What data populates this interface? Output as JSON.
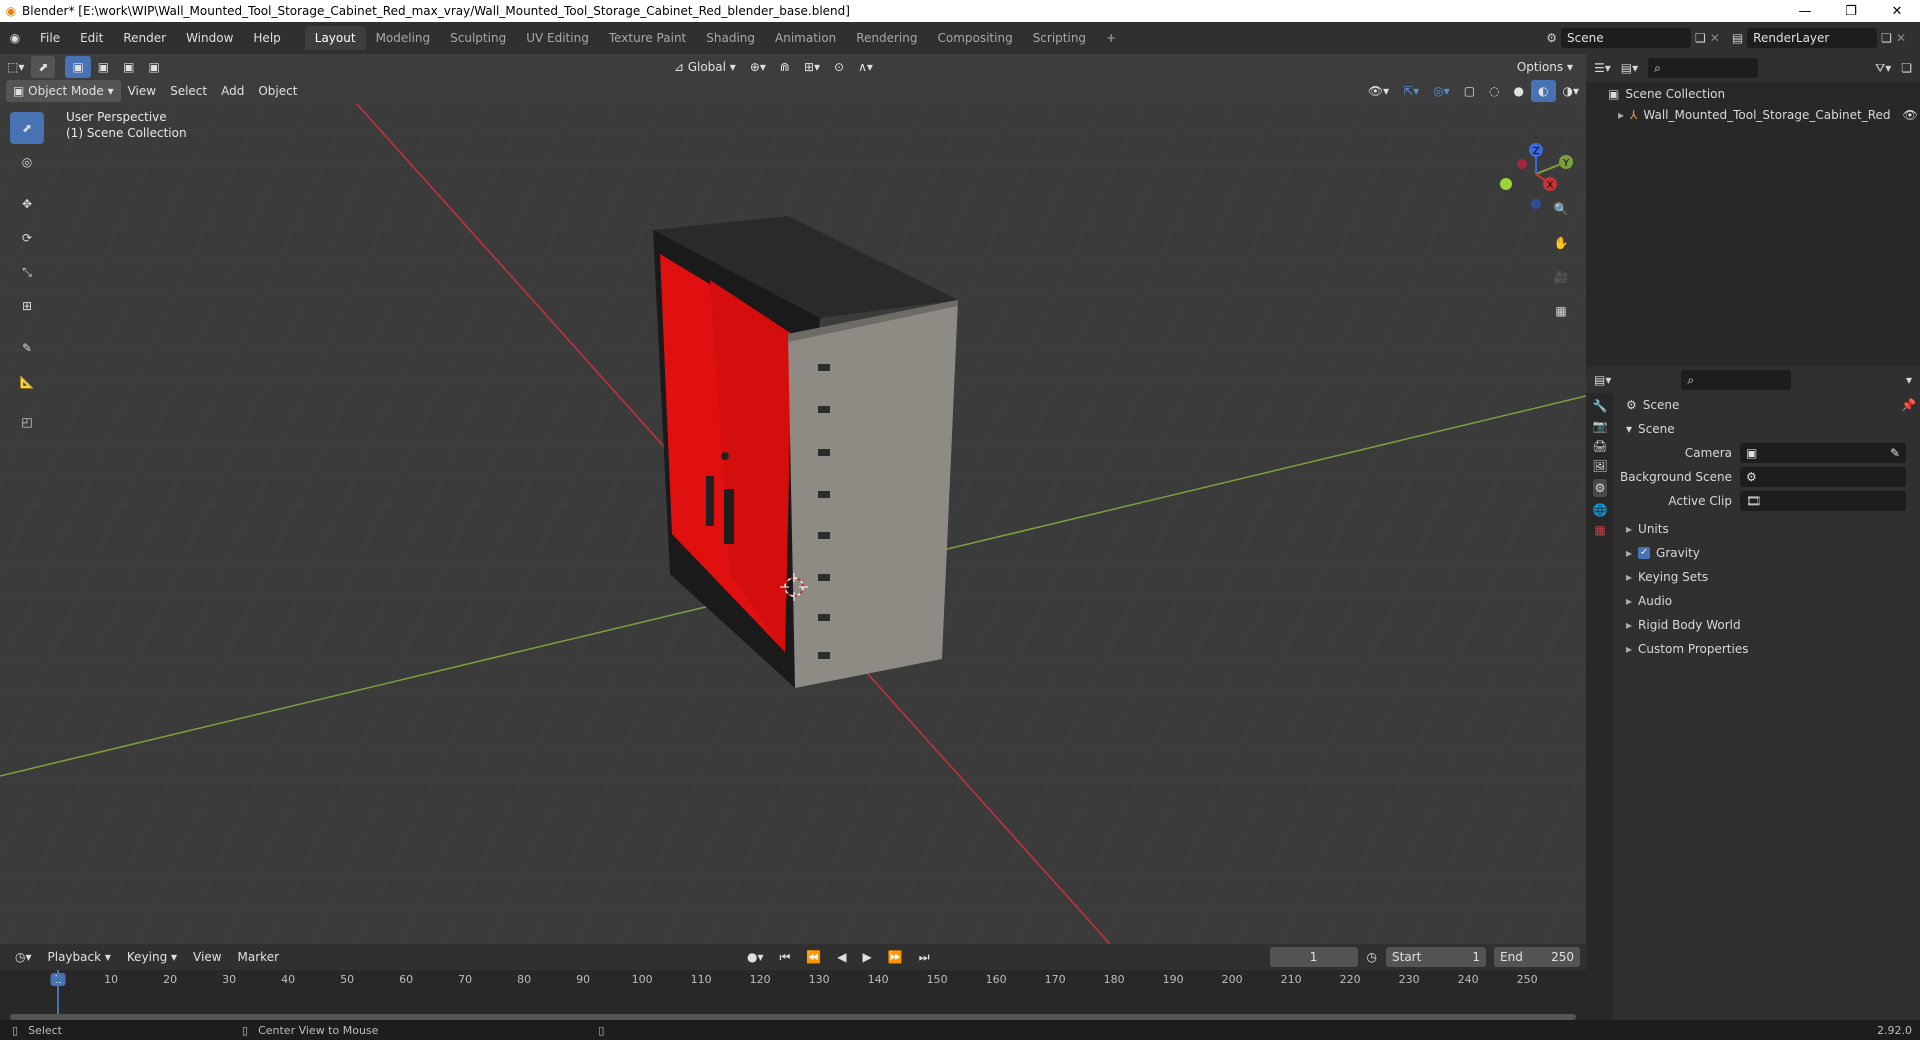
{
  "window": {
    "title": "Blender* [E:\\work\\WIP\\Wall_Mounted_Tool_Storage_Cabinet_Red_max_vray/Wall_Mounted_Tool_Storage_Cabinet_Red_blender_base.blend]",
    "minimize": "—",
    "restore": "❐",
    "close": "✕"
  },
  "menus": [
    "File",
    "Edit",
    "Render",
    "Window",
    "Help"
  ],
  "workspaces": [
    "Layout",
    "Modeling",
    "Sculpting",
    "UV Editing",
    "Texture Paint",
    "Shading",
    "Animation",
    "Rendering",
    "Compositing",
    "Scripting"
  ],
  "workspace_add": "+",
  "scene_name": "Scene",
  "render_layer": "RenderLayer",
  "viewport": {
    "transform_orientation": "Global",
    "options_label": "Options",
    "mode": "Object Mode",
    "menus": [
      "View",
      "Select",
      "Add",
      "Object"
    ],
    "overlay_line1": "User Perspective",
    "overlay_line2": "(1) Scene Collection",
    "gizmo": {
      "z": "Z",
      "y": "Y",
      "x": "X"
    }
  },
  "outliner": {
    "root": "Scene Collection",
    "items": [
      "Wall_Mounted_Tool_Storage_Cabinet_Red"
    ]
  },
  "properties": {
    "header": "Scene",
    "section": "Scene",
    "fields": [
      {
        "label": "Camera"
      },
      {
        "label": "Background Scene"
      },
      {
        "label": "Active Clip"
      }
    ],
    "subsections": [
      "Units",
      "Gravity",
      "Keying Sets",
      "Audio",
      "Rigid Body World",
      "Custom Properties"
    ],
    "gravity_checked": true
  },
  "timeline": {
    "menus": [
      "Playback",
      "Keying",
      "View",
      "Marker"
    ],
    "current_frame": "1",
    "start_label": "Start",
    "start": "1",
    "end_label": "End",
    "end": "250",
    "ruler": [
      "1",
      "10",
      "20",
      "30",
      "40",
      "50",
      "60",
      "70",
      "80",
      "90",
      "100",
      "110",
      "120",
      "130",
      "140",
      "150",
      "160",
      "170",
      "180",
      "190",
      "200",
      "210",
      "220",
      "230",
      "240",
      "250"
    ]
  },
  "statusbar": {
    "left": "Select",
    "middle": "Center View to Mouse",
    "version": "2.92.0"
  },
  "colors": {
    "accent": "#4772b3",
    "cabinet_red": "#e01010",
    "x_axis": "#c8323c",
    "y_axis": "#7ba23a"
  }
}
